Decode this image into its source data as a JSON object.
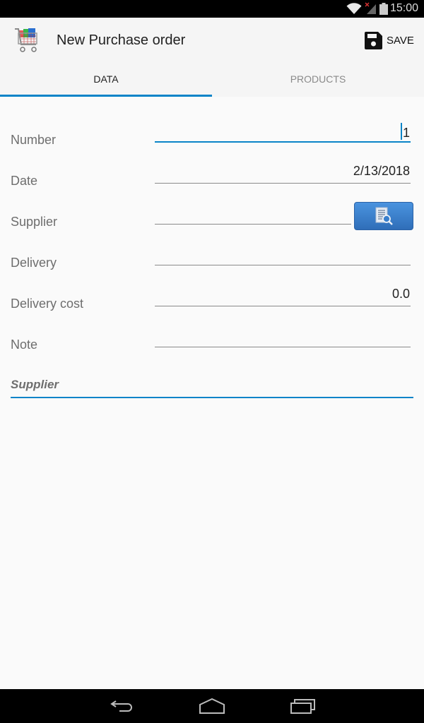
{
  "status_bar": {
    "time": "15:00",
    "icons": [
      "wifi-icon",
      "signal-icon",
      "battery-icon"
    ]
  },
  "app_bar": {
    "icon": "shopping-cart-icon",
    "title": "New Purchase order",
    "save_icon": "floppy-disk-icon",
    "save_label": "SAVE"
  },
  "tabs": [
    {
      "label": "DATA",
      "active": true
    },
    {
      "label": "PRODUCTS",
      "active": false
    }
  ],
  "form": {
    "fields": [
      {
        "label": "Number",
        "value": "1",
        "focused": true
      },
      {
        "label": "Date",
        "value": "2/13/2018"
      },
      {
        "label": "Supplier",
        "value": "",
        "lookup_icon": "document-search-icon"
      },
      {
        "label": "Delivery",
        "value": ""
      },
      {
        "label": "Delivery cost",
        "value": "0.0"
      },
      {
        "label": "Note",
        "value": ""
      }
    ],
    "section_header": "Supplier"
  },
  "nav_bar": {
    "buttons": [
      "back-icon",
      "home-icon",
      "recent-apps-icon"
    ]
  },
  "colors": {
    "accent": "#0a84c8",
    "lookup_button": "#3a7fcc"
  }
}
